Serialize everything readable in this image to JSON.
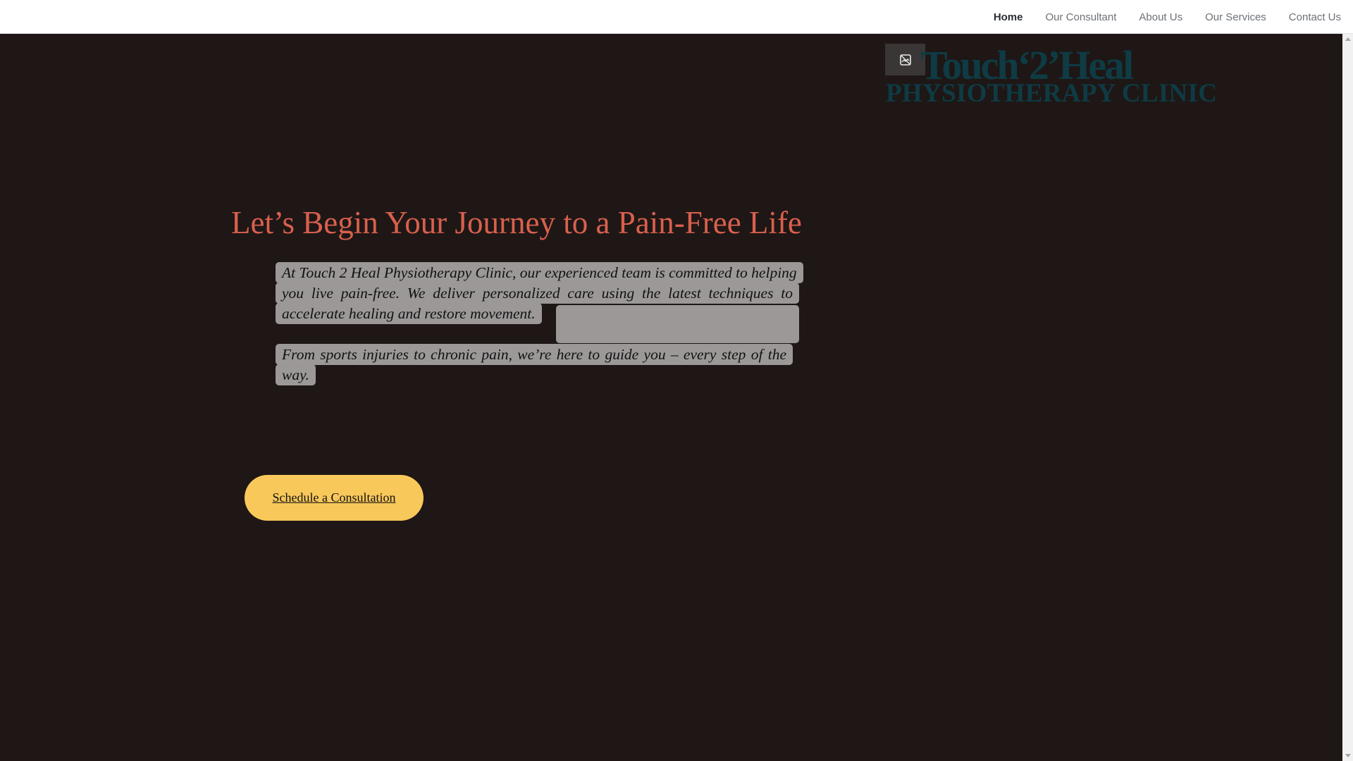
{
  "nav": {
    "items": [
      {
        "label": "Home",
        "active": true
      },
      {
        "label": "Our Consultant",
        "active": false
      },
      {
        "label": "About Us",
        "active": false
      },
      {
        "label": "Our Services",
        "active": false
      },
      {
        "label": "Contact Us",
        "active": false
      }
    ]
  },
  "logo": {
    "title": "Touch‘2’Heal",
    "subtitle": "PHYSIOTHERAPY CLINIC",
    "icon": "broken-image-icon"
  },
  "hero": {
    "headline": "Let’s Begin Your Journey to a Pain-Free Life",
    "paragraph_1": "At Touch 2 Heal Physiotherapy Clinic, our experienced team is committed to helping you live pain-free. We deliver personalized care using the latest techniques to accelerate healing and restore movement.",
    "paragraph_2": "From sports injuries to chronic pain, we’re here to guide you – every step of the way.",
    "cta_label": "Schedule a Consultation"
  },
  "colors": {
    "background": "#1e1716",
    "headline": "#d9604d",
    "logo": "#0e3b44",
    "cta": "#f9c85a",
    "text_highlight": "#9c9898"
  }
}
